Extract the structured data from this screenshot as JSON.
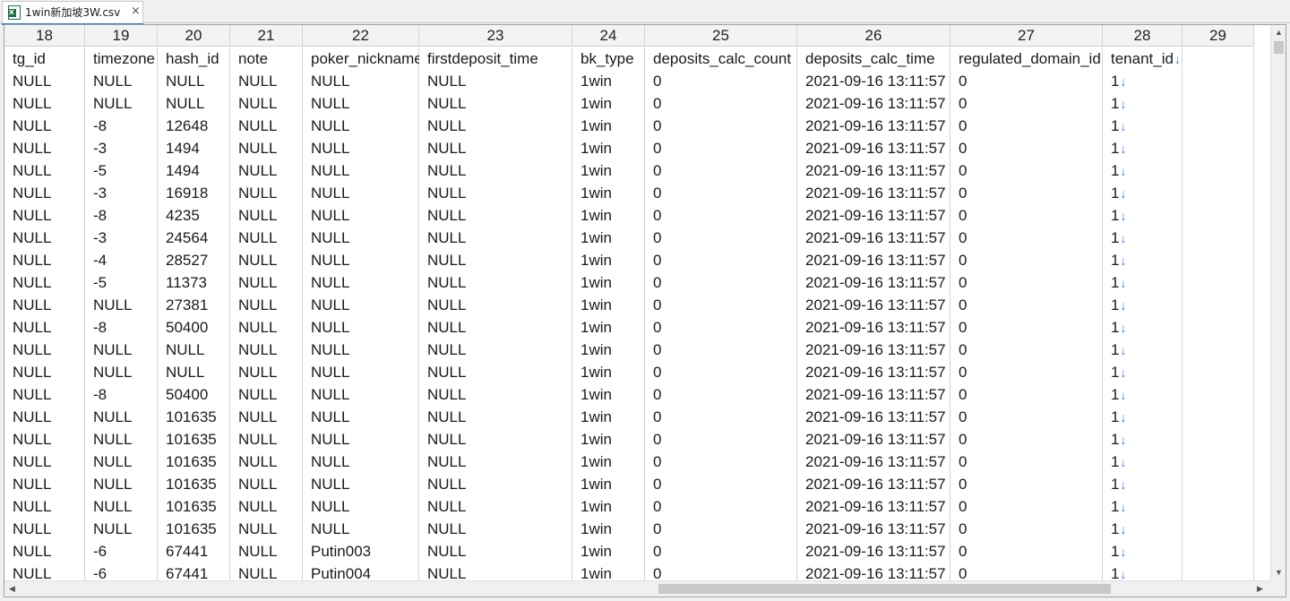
{
  "tab": {
    "title": "1win新加坡3W.csv",
    "icon": "excel-file-icon",
    "close_glyph": "×"
  },
  "column_numbers": [
    "18",
    "19",
    "20",
    "21",
    "22",
    "23",
    "24",
    "25",
    "26",
    "27",
    "28",
    "29"
  ],
  "header_row": [
    "tg_id",
    "timezone",
    "hash_id",
    "note",
    "poker_nickname",
    "firstdeposit_time",
    "bk_type",
    "deposits_calc_count",
    "deposits_calc_time",
    "regulated_domain_id",
    "tenant_id",
    ""
  ],
  "rows": [
    [
      "NULL",
      "NULL",
      "NULL",
      "NULL",
      "NULL",
      "NULL",
      "1win",
      "0",
      "2021-09-16 13:11:57",
      "0",
      "1",
      ""
    ],
    [
      "NULL",
      "NULL",
      "NULL",
      "NULL",
      "NULL",
      "NULL",
      "1win",
      "0",
      "2021-09-16 13:11:57",
      "0",
      "1",
      ""
    ],
    [
      "NULL",
      "-8",
      "12648",
      "NULL",
      "NULL",
      "NULL",
      "1win",
      "0",
      "2021-09-16 13:11:57",
      "0",
      "1",
      ""
    ],
    [
      "NULL",
      "-3",
      "1494",
      "NULL",
      "NULL",
      "NULL",
      "1win",
      "0",
      "2021-09-16 13:11:57",
      "0",
      "1",
      ""
    ],
    [
      "NULL",
      "-5",
      "1494",
      "NULL",
      "NULL",
      "NULL",
      "1win",
      "0",
      "2021-09-16 13:11:57",
      "0",
      "1",
      ""
    ],
    [
      "NULL",
      "-3",
      "16918",
      "NULL",
      "NULL",
      "NULL",
      "1win",
      "0",
      "2021-09-16 13:11:57",
      "0",
      "1",
      ""
    ],
    [
      "NULL",
      "-8",
      "4235",
      "NULL",
      "NULL",
      "NULL",
      "1win",
      "0",
      "2021-09-16 13:11:57",
      "0",
      "1",
      ""
    ],
    [
      "NULL",
      "-3",
      "24564",
      "NULL",
      "NULL",
      "NULL",
      "1win",
      "0",
      "2021-09-16 13:11:57",
      "0",
      "1",
      ""
    ],
    [
      "NULL",
      "-4",
      "28527",
      "NULL",
      "NULL",
      "NULL",
      "1win",
      "0",
      "2021-09-16 13:11:57",
      "0",
      "1",
      ""
    ],
    [
      "NULL",
      "-5",
      "11373",
      "NULL",
      "NULL",
      "NULL",
      "1win",
      "0",
      "2021-09-16 13:11:57",
      "0",
      "1",
      ""
    ],
    [
      "NULL",
      "NULL",
      "27381",
      "NULL",
      "NULL",
      "NULL",
      "1win",
      "0",
      "2021-09-16 13:11:57",
      "0",
      "1",
      ""
    ],
    [
      "NULL",
      "-8",
      "50400",
      "NULL",
      "NULL",
      "NULL",
      "1win",
      "0",
      "2021-09-16 13:11:57",
      "0",
      "1",
      ""
    ],
    [
      "NULL",
      "NULL",
      "NULL",
      "NULL",
      "NULL",
      "NULL",
      "1win",
      "0",
      "2021-09-16 13:11:57",
      "0",
      "1",
      ""
    ],
    [
      "NULL",
      "NULL",
      "NULL",
      "NULL",
      "NULL",
      "NULL",
      "1win",
      "0",
      "2021-09-16 13:11:57",
      "0",
      "1",
      ""
    ],
    [
      "NULL",
      "-8",
      "50400",
      "NULL",
      "NULL",
      "NULL",
      "1win",
      "0",
      "2021-09-16 13:11:57",
      "0",
      "1",
      ""
    ],
    [
      "NULL",
      "NULL",
      "101635",
      "NULL",
      "NULL",
      "NULL",
      "1win",
      "0",
      "2021-09-16 13:11:57",
      "0",
      "1",
      ""
    ],
    [
      "NULL",
      "NULL",
      "101635",
      "NULL",
      "NULL",
      "NULL",
      "1win",
      "0",
      "2021-09-16 13:11:57",
      "0",
      "1",
      ""
    ],
    [
      "NULL",
      "NULL",
      "101635",
      "NULL",
      "NULL",
      "NULL",
      "1win",
      "0",
      "2021-09-16 13:11:57",
      "0",
      "1",
      ""
    ],
    [
      "NULL",
      "NULL",
      "101635",
      "NULL",
      "NULL",
      "NULL",
      "1win",
      "0",
      "2021-09-16 13:11:57",
      "0",
      "1",
      ""
    ],
    [
      "NULL",
      "NULL",
      "101635",
      "NULL",
      "NULL",
      "NULL",
      "1win",
      "0",
      "2021-09-16 13:11:57",
      "0",
      "1",
      ""
    ],
    [
      "NULL",
      "NULL",
      "101635",
      "NULL",
      "NULL",
      "NULL",
      "1win",
      "0",
      "2021-09-16 13:11:57",
      "0",
      "1",
      ""
    ],
    [
      "NULL",
      "-6",
      "67441",
      "NULL",
      "Putin003",
      "NULL",
      "1win",
      "0",
      "2021-09-16 13:11:57",
      "0",
      "1",
      ""
    ],
    [
      "NULL",
      "-6",
      "67441",
      "NULL",
      "Putin004",
      "NULL",
      "1win",
      "0",
      "2021-09-16 13:11:57",
      "0",
      "1",
      ""
    ]
  ],
  "line_break_marker": "↓",
  "scrollbars": {
    "up_icon": "▲",
    "down_icon": "▼",
    "left_icon": "◀",
    "right_icon": "▶"
  }
}
